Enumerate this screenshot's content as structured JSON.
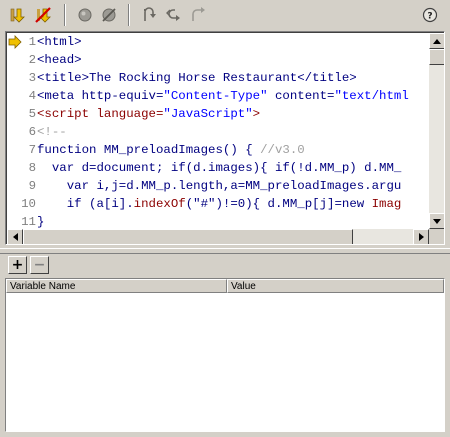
{
  "toolbar": {
    "buttons": [
      {
        "name": "step-into-icon"
      },
      {
        "name": "stop-debug-icon"
      },
      {
        "name": "set-breakpoint-icon"
      },
      {
        "name": "remove-breakpoints-icon"
      },
      {
        "name": "step-over-icon"
      },
      {
        "name": "step-in-icon"
      },
      {
        "name": "step-out-icon"
      },
      {
        "name": "help-icon"
      }
    ]
  },
  "code_view": {
    "current_line": 1,
    "line_numbers": [
      "1",
      "2",
      "3",
      "4",
      "5",
      "6",
      "7",
      "8",
      "9",
      "10",
      "11"
    ],
    "lines": [
      [
        {
          "t": "<html>",
          "c": "tag"
        }
      ],
      [
        {
          "t": "<head>",
          "c": "tag"
        }
      ],
      [
        {
          "t": "<title>The Rocking Horse Restaurant</title>",
          "c": "tag"
        }
      ],
      [
        {
          "t": "<meta http-equiv=",
          "c": "tag"
        },
        {
          "t": "\"Content-Type\"",
          "c": "str"
        },
        {
          "t": " content=",
          "c": "tag"
        },
        {
          "t": "\"text/html",
          "c": "str"
        }
      ],
      [
        {
          "t": "<script language=",
          "c": "script"
        },
        {
          "t": "\"JavaScript\"",
          "c": "str"
        },
        {
          "t": ">",
          "c": "script"
        }
      ],
      [
        {
          "t": "<!--",
          "c": "comment"
        }
      ],
      [
        {
          "t": "function MM_preloadImages() { ",
          "c": "kw"
        },
        {
          "t": "//v3.0",
          "c": "cmt"
        }
      ],
      [
        {
          "t": "  var d=document; if(d.images){ if(!d.MM_p) d.MM_",
          "c": "kw"
        }
      ],
      [
        {
          "t": "    var i,j=d.MM_p.length,a=MM_preloadImages.argu",
          "c": "kw"
        }
      ],
      [
        {
          "t": "    if (a[i].",
          "c": "kw"
        },
        {
          "t": "indexOf",
          "c": "name"
        },
        {
          "t": "(\"#\")!=0){ d.MM_p[j]=new ",
          "c": "kw"
        },
        {
          "t": "Imag",
          "c": "name"
        }
      ],
      [
        {
          "t": "}",
          "c": "kw"
        }
      ]
    ]
  },
  "variables_panel": {
    "add_label": "+",
    "remove_label": "−",
    "columns": [
      "Variable Name",
      "Value"
    ]
  }
}
